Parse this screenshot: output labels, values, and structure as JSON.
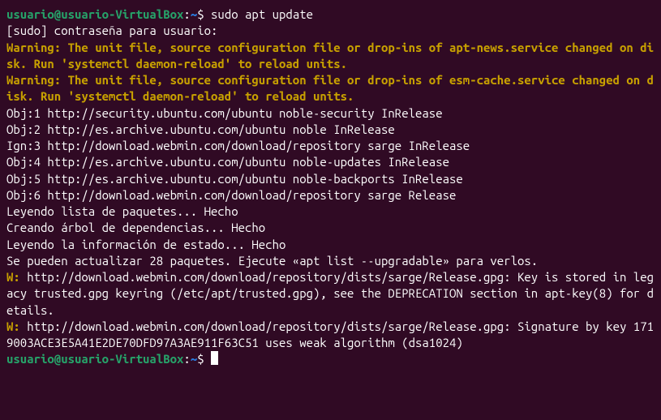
{
  "prompt1": {
    "user_host": "usuario@usuario-VirtualBox",
    "colon": ":",
    "path": "~",
    "dollar": "$ ",
    "command": "sudo apt update"
  },
  "sudo_prompt": "[sudo] contraseña para usuario: ",
  "warning1": "Warning: The unit file, source configuration file or drop-ins of apt-news.service changed on disk. Run 'systemctl daemon-reload' to reload units.",
  "warning2": "Warning: The unit file, source configuration file or drop-ins of esm-cache.service changed on disk. Run 'systemctl daemon-reload' to reload units.",
  "obj1": "Obj:1 http://security.ubuntu.com/ubuntu noble-security InRelease",
  "obj2": "Obj:2 http://es.archive.ubuntu.com/ubuntu noble InRelease",
  "ign3": "Ign:3 http://download.webmin.com/download/repository sarge InRelease",
  "obj4": "Obj:4 http://es.archive.ubuntu.com/ubuntu noble-updates InRelease",
  "obj5": "Obj:5 http://es.archive.ubuntu.com/ubuntu noble-backports InRelease",
  "obj6": "Obj:6 http://download.webmin.com/download/repository sarge Release",
  "reading_pkg": "Leyendo lista de paquetes... Hecho",
  "building_tree": "Creando árbol de dependencias... Hecho",
  "reading_state": "Leyendo la información de estado... Hecho",
  "upgradable": "Se pueden actualizar 28 paquetes. Ejecute «apt list --upgradable» para verlos.",
  "w_prefix": "W: ",
  "warn_key1": "http://download.webmin.com/download/repository/dists/sarge/Release.gpg: Key is stored in legacy trusted.gpg keyring (/etc/apt/trusted.gpg), see the DEPRECATION section in apt-key(8) for details.",
  "warn_key2": "http://download.webmin.com/download/repository/dists/sarge/Release.gpg: Signature by key 1719003ACE3E5A41E2DE70DFD97A3AE911F63C51 uses weak algorithm (dsa1024)",
  "prompt2": {
    "user_host": "usuario@usuario-VirtualBox",
    "colon": ":",
    "path": "~",
    "dollar": "$ "
  }
}
